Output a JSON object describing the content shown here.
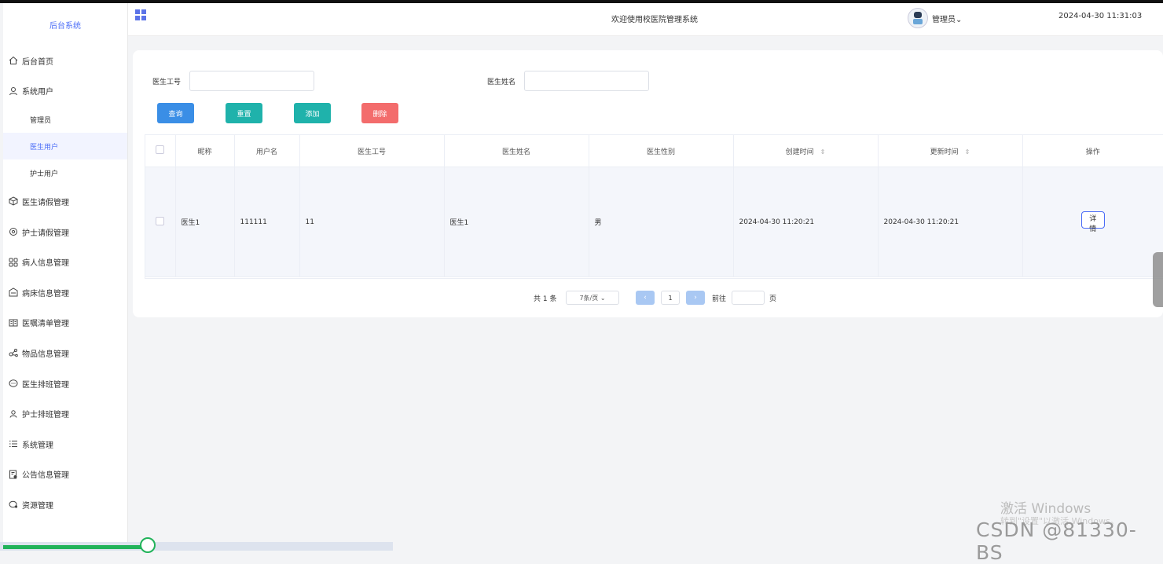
{
  "sidebar": {
    "brand": "后台系统",
    "items": [
      {
        "label": "后台首页",
        "icon": "home-icon"
      },
      {
        "label": "系统用户",
        "icon": "user-icon"
      },
      {
        "label": "医生请假管理",
        "icon": "cube-icon"
      },
      {
        "label": "护士请假管理",
        "icon": "settings-icon"
      },
      {
        "label": "病人信息管理",
        "icon": "grid-icon"
      },
      {
        "label": "病床信息管理",
        "icon": "bed-icon"
      },
      {
        "label": "医嘱清单管理",
        "icon": "book-icon"
      },
      {
        "label": "物品信息管理",
        "icon": "share-icon"
      },
      {
        "label": "医生排班管理",
        "icon": "chat-icon"
      },
      {
        "label": "护士排班管理",
        "icon": "users-icon"
      },
      {
        "label": "系统管理",
        "icon": "list-icon"
      },
      {
        "label": "公告信息管理",
        "icon": "notice-icon"
      },
      {
        "label": "资源管理",
        "icon": "resource-icon"
      }
    ],
    "sub_items": [
      {
        "label": "管理员"
      },
      {
        "label": "医生用户",
        "active": true
      },
      {
        "label": "护士用户"
      }
    ]
  },
  "header": {
    "title": "欢迎使用校医院管理系统",
    "user": "管理员",
    "time": "2024-04-30 11:31:03"
  },
  "filters": {
    "doctor_id_label": "医生工号",
    "doctor_name_label": "医生姓名"
  },
  "buttons": {
    "query": "查询",
    "reset": "重置",
    "add": "添加",
    "delete": "删除"
  },
  "table": {
    "columns": [
      "昵称",
      "用户名",
      "医生工号",
      "医生姓名",
      "医生性别",
      "创建时间",
      "更新时间",
      "操作"
    ],
    "rows": [
      {
        "nickname": "医生1",
        "username": "111111",
        "doctor_id": "11",
        "doctor_name": "医生1",
        "gender": "男",
        "created": "2024-04-30 11:20:21",
        "updated": "2024-04-30 11:20:21",
        "action": "详情"
      }
    ]
  },
  "pagination": {
    "total": "共 1 条",
    "page_size": "7条/页",
    "page": "1",
    "goto": "前往",
    "unit": "页"
  },
  "watermark": {
    "activate": "激活 Windows",
    "activate_hint": "转到\"设置\"以激活 Windows。",
    "csdn": "CSDN @81330-BS"
  },
  "colors": {
    "primary": "#3a8ee6",
    "teal": "#1fb2ab",
    "danger": "#f36c6c",
    "accent": "#4a6cf7"
  }
}
